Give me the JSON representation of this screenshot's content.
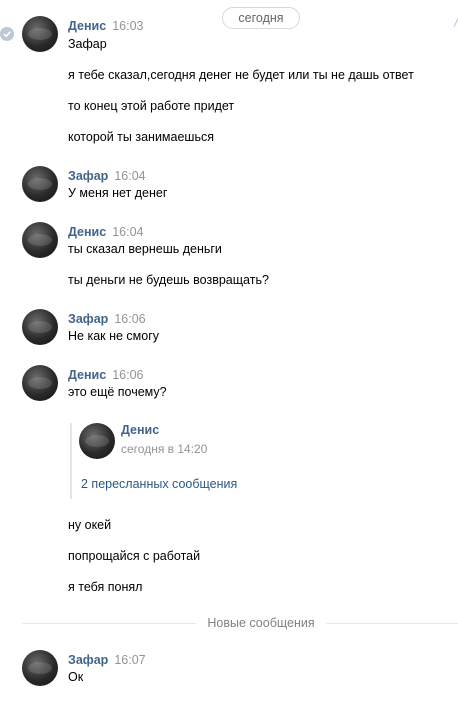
{
  "date_pill": "сегодня",
  "messages": [
    {
      "author": "Денис",
      "time": "16:03",
      "lines": [
        "Зафар",
        "я тебе сказал,сегодня денег не будет или ты не дашь ответ",
        "то конец этой работе придет",
        "которой ты занимаешься"
      ]
    },
    {
      "author": "Зафар",
      "time": "16:04",
      "lines": [
        "У меня нет денег"
      ]
    },
    {
      "author": "Денис",
      "time": "16:04",
      "lines": [
        "ты сказал вернешь деньги",
        "ты деньги не будешь возвращать?"
      ]
    },
    {
      "author": "Зафар",
      "time": "16:06",
      "lines": [
        "Не как не смогу"
      ]
    },
    {
      "author": "Денис",
      "time": "16:06",
      "lines": [
        "это ещё почему?",
        "ну окей",
        "попрощайся с работай",
        "я тебя понял"
      ]
    },
    {
      "author": "Зафар",
      "time": "16:07",
      "lines": [
        "Ок"
      ]
    }
  ],
  "forwarded": {
    "author": "Денис",
    "date": "сегодня в 14:20",
    "count_label": "2 пересланных сообщения"
  },
  "new_messages_label": "Новые сообщения"
}
